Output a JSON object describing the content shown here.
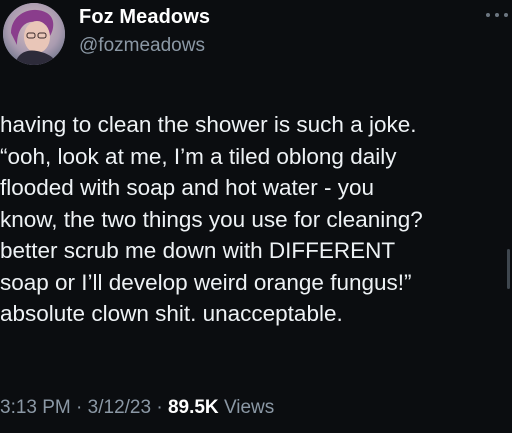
{
  "author": {
    "name": "Foz Meadows",
    "handle": "@fozmeadows"
  },
  "tweet": {
    "lines": [
      "having to clean the shower is such a joke.",
      "“ooh, look at me, I’m a tiled oblong daily",
      "flooded with soap and hot water - you",
      "know, the two things you use for cleaning?",
      "better scrub me down with DIFFERENT",
      "soap or I’ll develop weird orange fungus!”",
      "absolute clown shit. unacceptable."
    ]
  },
  "meta": {
    "time": "3:13 PM",
    "separator": "·",
    "date": "3/12/23",
    "views_count": "89.5K",
    "views_label": "Views"
  },
  "colors": {
    "background": "#0b0d10",
    "text": "#eef2f5",
    "secondary": "#8b98a5"
  },
  "icons": {
    "more": "more-horizontal-icon"
  }
}
